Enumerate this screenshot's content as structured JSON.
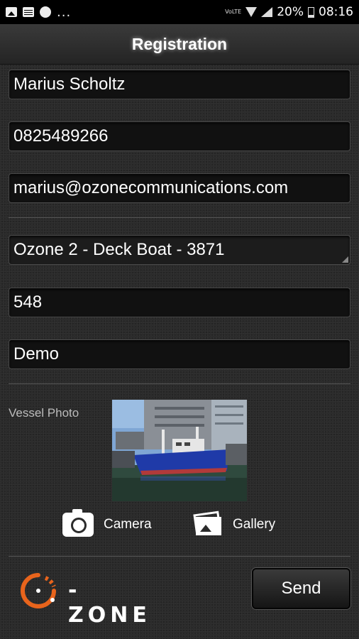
{
  "status_bar": {
    "volte_label": "VoLTE",
    "battery": "20%",
    "time": "08:16",
    "dots": "...",
    "icons": [
      "image-icon",
      "calendar-icon",
      "phone-icon",
      "wifi-icon",
      "signal-icon",
      "battery-icon"
    ]
  },
  "header": {
    "title": "Registration"
  },
  "form": {
    "name": "Marius Scholtz",
    "phone": "0825489266",
    "email": "marius@ozonecommunications.com",
    "vessel": "Ozone 2 - Deck Boat - 3871",
    "number": "548",
    "note": "Demo"
  },
  "photo": {
    "label": "Vessel Photo"
  },
  "actions": {
    "camera_label": "Camera",
    "gallery_label": "Gallery"
  },
  "footer": {
    "logo_text": "-ZONE",
    "send_label": "Send"
  },
  "colors": {
    "accent": "#e8641c",
    "background": "#2b2b2b"
  }
}
